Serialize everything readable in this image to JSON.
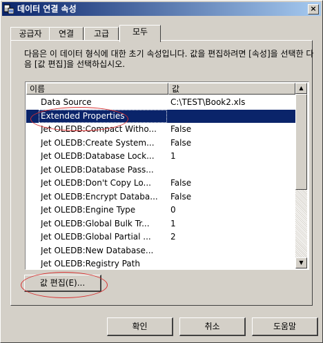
{
  "window": {
    "title": "데이터 연결 속성",
    "close_label": "×",
    "title_icon": "database-link-icon"
  },
  "tabs": [
    {
      "label": "공급자",
      "active": false
    },
    {
      "label": "연결",
      "active": false
    },
    {
      "label": "고급",
      "active": false
    },
    {
      "label": "모두",
      "active": true
    }
  ],
  "description": "다음은 이 데이터 형식에 대한 초기 속성입니다. 값을 편집하려면 [속성]을 선택한 다음 [값 편집]을 선택하십시오.",
  "list": {
    "headers": {
      "name": "이름",
      "value": "값"
    },
    "rows": [
      {
        "name": "Data Source",
        "value": "C:\\TEST\\Book2.xls"
      },
      {
        "name": "Extended Properties",
        "value": ""
      },
      {
        "name": "Jet OLEDB:Compact Witho...",
        "value": "False"
      },
      {
        "name": "Jet OLEDB:Create System...",
        "value": "False"
      },
      {
        "name": "Jet OLEDB:Database Lock...",
        "value": "1"
      },
      {
        "name": "Jet OLEDB:Database Pass...",
        "value": ""
      },
      {
        "name": "Jet OLEDB:Don't Copy Lo...",
        "value": "False"
      },
      {
        "name": "Jet OLEDB:Encrypt Databa...",
        "value": "False"
      },
      {
        "name": "Jet OLEDB:Engine Type",
        "value": "0"
      },
      {
        "name": "Jet OLEDB:Global Bulk Tr...",
        "value": "1"
      },
      {
        "name": "Jet OLEDB:Global Partial ...",
        "value": "2"
      },
      {
        "name": "Jet OLEDB:New Database...",
        "value": ""
      },
      {
        "name": "Jet OLEDB:Registry Path",
        "value": ""
      }
    ],
    "selected_index": 1,
    "scroll_up_icon": "▲",
    "scroll_down_icon": "▼"
  },
  "buttons": {
    "edit_value": "값 편집(E)...",
    "ok": "확인",
    "cancel": "취소",
    "help": "도움말"
  },
  "colors": {
    "selection": "#0a246a",
    "annotation": "#d83030",
    "face": "#d4d0c8"
  }
}
